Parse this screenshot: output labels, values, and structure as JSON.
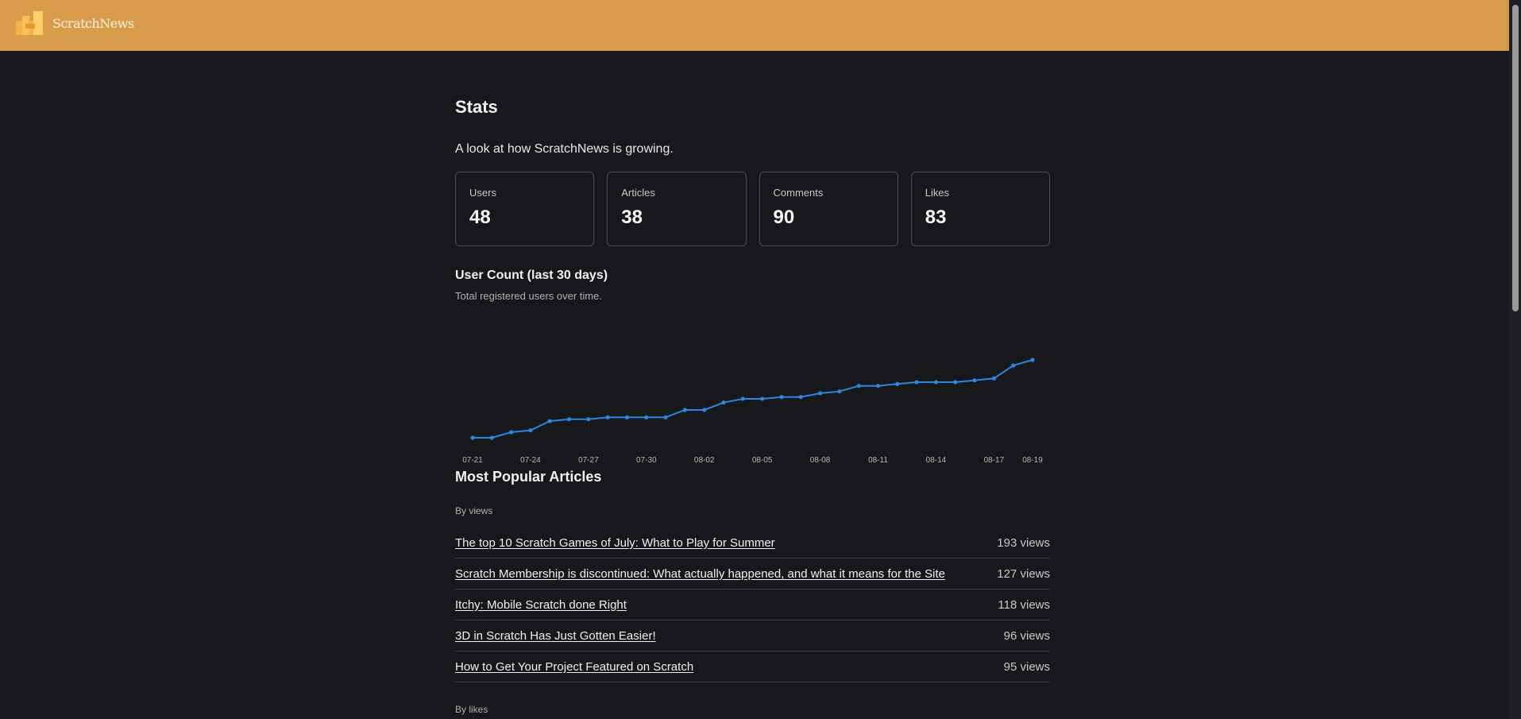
{
  "header": {
    "brand": "ScratchNews",
    "brand_color": "#d99c4a",
    "logo_icon": "scratchnews-logo-icon"
  },
  "page": {
    "title": "Stats",
    "intro": "A look at how ScratchNews is growing."
  },
  "stats": [
    {
      "label": "Users",
      "value": "48"
    },
    {
      "label": "Articles",
      "value": "38"
    },
    {
      "label": "Comments",
      "value": "90"
    },
    {
      "label": "Likes",
      "value": "83"
    }
  ],
  "chart_section": {
    "title": "User Count (last 30 days)",
    "subtitle": "Total registered users over time."
  },
  "chart_data": {
    "type": "line",
    "title": "User Count (last 30 days)",
    "subtitle": "Total registered users over time.",
    "xlabel": "",
    "ylabel": "",
    "grid": false,
    "line_color": "#2e86de",
    "x": [
      "07-21",
      "07-22",
      "07-23",
      "07-24",
      "07-25",
      "07-26",
      "07-27",
      "07-28",
      "07-29",
      "07-30",
      "07-31",
      "08-01",
      "08-02",
      "08-03",
      "08-04",
      "08-05",
      "08-06",
      "08-07",
      "08-08",
      "08-09",
      "08-10",
      "08-11",
      "08-12",
      "08-13",
      "08-14",
      "08-15",
      "08-16",
      "08-17",
      "08-18",
      "08-19"
    ],
    "values": [
      13,
      13,
      16,
      17,
      22,
      23,
      23,
      24,
      24,
      24,
      24,
      28,
      28,
      32,
      34,
      34,
      35,
      35,
      37,
      38,
      41,
      41,
      42,
      43,
      43,
      43,
      44,
      45,
      52,
      55
    ],
    "tick_labels": [
      "07-21",
      "07-24",
      "07-27",
      "07-30",
      "08-02",
      "08-05",
      "08-08",
      "08-11",
      "08-14",
      "08-17",
      "08-19"
    ],
    "ylim": [
      10,
      58
    ]
  },
  "popular": {
    "title": "Most Popular Articles",
    "by_views_label": "By views",
    "by_likes_label": "By likes",
    "articles": [
      {
        "title": "The top 10 Scratch Games of July: What to Play for Summer",
        "views": "193 views"
      },
      {
        "title": "Scratch Membership is discontinued: What actually happened, and what it means for the Site",
        "views": "127 views"
      },
      {
        "title": "Itchy: Mobile Scratch done Right",
        "views": "118 views"
      },
      {
        "title": "3D in Scratch Has Just Gotten Easier!",
        "views": "96 views"
      },
      {
        "title": "How to Get Your Project Featured on Scratch",
        "views": "95 views"
      }
    ]
  }
}
